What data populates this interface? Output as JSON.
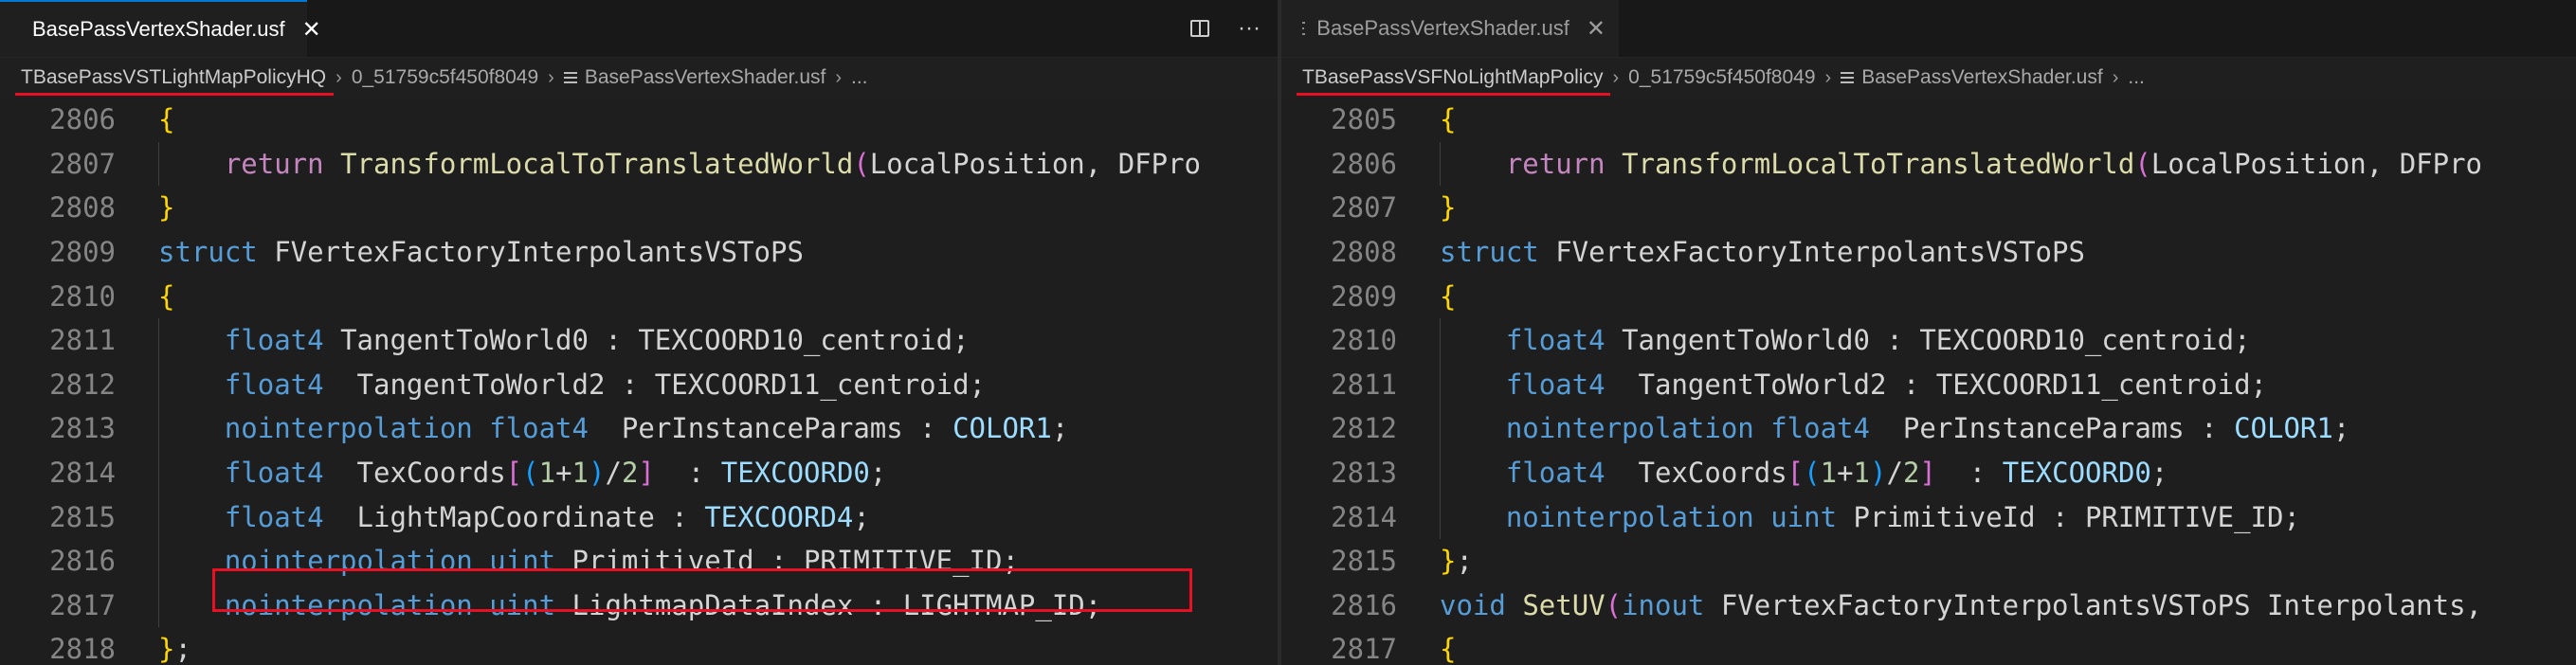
{
  "left": {
    "tab_title": "BasePassVertexShader.usf",
    "breadcrumb": [
      "TBasePassVSTLightMapPolicyHQ",
      "0_51759c5f450f8049",
      "BasePassVertexShader.usf",
      "..."
    ],
    "lines": [
      {
        "n": "2806",
        "parts": [
          [
            "br1",
            "{"
          ]
        ]
      },
      {
        "n": "2807",
        "parts": [
          [
            "plain",
            "    "
          ],
          [
            "ctl",
            "return"
          ],
          [
            "plain",
            " "
          ],
          [
            "fn",
            "TransformLocalToTranslatedWorld"
          ],
          [
            "br2",
            "("
          ],
          [
            "plain",
            "LocalPosition, DFPro"
          ]
        ]
      },
      {
        "n": "2808",
        "parts": [
          [
            "br1",
            "}"
          ]
        ]
      },
      {
        "n": "2809",
        "parts": [
          [
            "kw",
            "struct"
          ],
          [
            "plain",
            " FVertexFactoryInterpolantsVSToPS"
          ]
        ]
      },
      {
        "n": "2810",
        "parts": [
          [
            "br1",
            "{"
          ]
        ]
      },
      {
        "n": "2811",
        "parts": [
          [
            "plain",
            "    "
          ],
          [
            "kw",
            "float4"
          ],
          [
            "plain",
            " TangentToWorld0 : TEXCOORD10_centroid;"
          ]
        ]
      },
      {
        "n": "2812",
        "parts": [
          [
            "plain",
            "    "
          ],
          [
            "kw",
            "float4"
          ],
          [
            "plain",
            "  TangentToWorld2 : TEXCOORD11_centroid;"
          ]
        ]
      },
      {
        "n": "2813",
        "parts": [
          [
            "plain",
            "    "
          ],
          [
            "kw",
            "nointerpolation"
          ],
          [
            "plain",
            " "
          ],
          [
            "kw",
            "float4"
          ],
          [
            "plain",
            "  PerInstanceParams : "
          ],
          [
            "var",
            "COLOR1"
          ],
          [
            "plain",
            ";"
          ]
        ]
      },
      {
        "n": "2814",
        "parts": [
          [
            "plain",
            "    "
          ],
          [
            "kw",
            "float4"
          ],
          [
            "plain",
            "  TexCoords"
          ],
          [
            "br2",
            "["
          ],
          [
            "br3",
            "("
          ],
          [
            "num",
            "1"
          ],
          [
            "plain",
            "+"
          ],
          [
            "num",
            "1"
          ],
          [
            "br3",
            ")"
          ],
          [
            "plain",
            "/"
          ],
          [
            "num",
            "2"
          ],
          [
            "br2",
            "]"
          ],
          [
            "plain",
            "  : "
          ],
          [
            "var",
            "TEXCOORD0"
          ],
          [
            "plain",
            ";"
          ]
        ]
      },
      {
        "n": "2815",
        "parts": [
          [
            "plain",
            "    "
          ],
          [
            "kw",
            "float4"
          ],
          [
            "plain",
            "  LightMapCoordinate : "
          ],
          [
            "var",
            "TEXCOORD4"
          ],
          [
            "plain",
            ";"
          ]
        ]
      },
      {
        "n": "2816",
        "parts": [
          [
            "plain",
            "    "
          ],
          [
            "kw",
            "nointerpolation"
          ],
          [
            "plain",
            " "
          ],
          [
            "kw",
            "uint"
          ],
          [
            "plain",
            " PrimitiveId : PRIMITIVE_ID;"
          ]
        ]
      },
      {
        "n": "2817",
        "parts": [
          [
            "plain",
            "    "
          ],
          [
            "kw",
            "nointerpolation"
          ],
          [
            "plain",
            " "
          ],
          [
            "kw",
            "uint"
          ],
          [
            "plain",
            " LightmapDataIndex : LIGHTMAP_ID;"
          ]
        ]
      },
      {
        "n": "2818",
        "parts": [
          [
            "br1",
            "}"
          ],
          [
            "plain",
            ";"
          ]
        ]
      }
    ]
  },
  "right": {
    "tab_title": "BasePassVertexShader.usf",
    "breadcrumb": [
      "TBasePassVSFNoLightMapPolicy",
      "0_51759c5f450f8049",
      "BasePassVertexShader.usf",
      "..."
    ],
    "lines": [
      {
        "n": "2805",
        "parts": [
          [
            "br1",
            "{"
          ]
        ]
      },
      {
        "n": "2806",
        "parts": [
          [
            "plain",
            "    "
          ],
          [
            "ctl",
            "return"
          ],
          [
            "plain",
            " "
          ],
          [
            "fn",
            "TransformLocalToTranslatedWorld"
          ],
          [
            "br2",
            "("
          ],
          [
            "plain",
            "LocalPosition, DFPro"
          ]
        ]
      },
      {
        "n": "2807",
        "parts": [
          [
            "br1",
            "}"
          ]
        ]
      },
      {
        "n": "2808",
        "parts": [
          [
            "kw",
            "struct"
          ],
          [
            "plain",
            " FVertexFactoryInterpolantsVSToPS"
          ]
        ]
      },
      {
        "n": "2809",
        "parts": [
          [
            "br1",
            "{"
          ]
        ]
      },
      {
        "n": "2810",
        "parts": [
          [
            "plain",
            "    "
          ],
          [
            "kw",
            "float4"
          ],
          [
            "plain",
            " TangentToWorld0 : TEXCOORD10_centroid;"
          ]
        ]
      },
      {
        "n": "2811",
        "parts": [
          [
            "plain",
            "    "
          ],
          [
            "kw",
            "float4"
          ],
          [
            "plain",
            "  TangentToWorld2 : TEXCOORD11_centroid;"
          ]
        ]
      },
      {
        "n": "2812",
        "parts": [
          [
            "plain",
            "    "
          ],
          [
            "kw",
            "nointerpolation"
          ],
          [
            "plain",
            " "
          ],
          [
            "kw",
            "float4"
          ],
          [
            "plain",
            "  PerInstanceParams : "
          ],
          [
            "var",
            "COLOR1"
          ],
          [
            "plain",
            ";"
          ]
        ]
      },
      {
        "n": "2813",
        "parts": [
          [
            "plain",
            "    "
          ],
          [
            "kw",
            "float4"
          ],
          [
            "plain",
            "  TexCoords"
          ],
          [
            "br2",
            "["
          ],
          [
            "br3",
            "("
          ],
          [
            "num",
            "1"
          ],
          [
            "plain",
            "+"
          ],
          [
            "num",
            "1"
          ],
          [
            "br3",
            ")"
          ],
          [
            "plain",
            "/"
          ],
          [
            "num",
            "2"
          ],
          [
            "br2",
            "]"
          ],
          [
            "plain",
            "  : "
          ],
          [
            "var",
            "TEXCOORD0"
          ],
          [
            "plain",
            ";"
          ]
        ]
      },
      {
        "n": "2814",
        "parts": [
          [
            "plain",
            "    "
          ],
          [
            "kw",
            "nointerpolation"
          ],
          [
            "plain",
            " "
          ],
          [
            "kw",
            "uint"
          ],
          [
            "plain",
            " PrimitiveId : PRIMITIVE_ID;"
          ]
        ]
      },
      {
        "n": "2815",
        "parts": [
          [
            "br1",
            "}"
          ],
          [
            "plain",
            ";"
          ]
        ]
      },
      {
        "n": "2816",
        "parts": [
          [
            "kw",
            "void"
          ],
          [
            "plain",
            " "
          ],
          [
            "fn",
            "SetUV"
          ],
          [
            "br2",
            "("
          ],
          [
            "kw",
            "inout"
          ],
          [
            "plain",
            " FVertexFactoryInterpolantsVSToPS Interpolants,"
          ]
        ]
      },
      {
        "n": "2817",
        "parts": [
          [
            "br1",
            "{"
          ]
        ]
      }
    ]
  },
  "actions": {
    "split_icon": "split-editor-icon",
    "more_label": "···"
  },
  "colors": {
    "highlight": "#e81123",
    "accent": "#0078d4"
  }
}
